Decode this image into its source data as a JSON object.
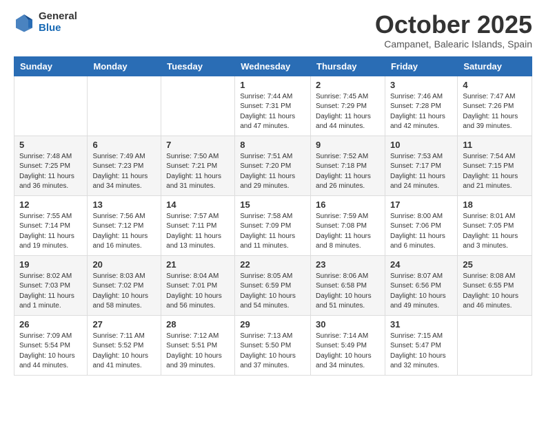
{
  "logo": {
    "general": "General",
    "blue": "Blue"
  },
  "title": "October 2025",
  "location": "Campanet, Balearic Islands, Spain",
  "headers": [
    "Sunday",
    "Monday",
    "Tuesday",
    "Wednesday",
    "Thursday",
    "Friday",
    "Saturday"
  ],
  "weeks": [
    [
      {
        "day": "",
        "info": ""
      },
      {
        "day": "",
        "info": ""
      },
      {
        "day": "",
        "info": ""
      },
      {
        "day": "1",
        "info": "Sunrise: 7:44 AM\nSunset: 7:31 PM\nDaylight: 11 hours and 47 minutes."
      },
      {
        "day": "2",
        "info": "Sunrise: 7:45 AM\nSunset: 7:29 PM\nDaylight: 11 hours and 44 minutes."
      },
      {
        "day": "3",
        "info": "Sunrise: 7:46 AM\nSunset: 7:28 PM\nDaylight: 11 hours and 42 minutes."
      },
      {
        "day": "4",
        "info": "Sunrise: 7:47 AM\nSunset: 7:26 PM\nDaylight: 11 hours and 39 minutes."
      }
    ],
    [
      {
        "day": "5",
        "info": "Sunrise: 7:48 AM\nSunset: 7:25 PM\nDaylight: 11 hours and 36 minutes."
      },
      {
        "day": "6",
        "info": "Sunrise: 7:49 AM\nSunset: 7:23 PM\nDaylight: 11 hours and 34 minutes."
      },
      {
        "day": "7",
        "info": "Sunrise: 7:50 AM\nSunset: 7:21 PM\nDaylight: 11 hours and 31 minutes."
      },
      {
        "day": "8",
        "info": "Sunrise: 7:51 AM\nSunset: 7:20 PM\nDaylight: 11 hours and 29 minutes."
      },
      {
        "day": "9",
        "info": "Sunrise: 7:52 AM\nSunset: 7:18 PM\nDaylight: 11 hours and 26 minutes."
      },
      {
        "day": "10",
        "info": "Sunrise: 7:53 AM\nSunset: 7:17 PM\nDaylight: 11 hours and 24 minutes."
      },
      {
        "day": "11",
        "info": "Sunrise: 7:54 AM\nSunset: 7:15 PM\nDaylight: 11 hours and 21 minutes."
      }
    ],
    [
      {
        "day": "12",
        "info": "Sunrise: 7:55 AM\nSunset: 7:14 PM\nDaylight: 11 hours and 19 minutes."
      },
      {
        "day": "13",
        "info": "Sunrise: 7:56 AM\nSunset: 7:12 PM\nDaylight: 11 hours and 16 minutes."
      },
      {
        "day": "14",
        "info": "Sunrise: 7:57 AM\nSunset: 7:11 PM\nDaylight: 11 hours and 13 minutes."
      },
      {
        "day": "15",
        "info": "Sunrise: 7:58 AM\nSunset: 7:09 PM\nDaylight: 11 hours and 11 minutes."
      },
      {
        "day": "16",
        "info": "Sunrise: 7:59 AM\nSunset: 7:08 PM\nDaylight: 11 hours and 8 minutes."
      },
      {
        "day": "17",
        "info": "Sunrise: 8:00 AM\nSunset: 7:06 PM\nDaylight: 11 hours and 6 minutes."
      },
      {
        "day": "18",
        "info": "Sunrise: 8:01 AM\nSunset: 7:05 PM\nDaylight: 11 hours and 3 minutes."
      }
    ],
    [
      {
        "day": "19",
        "info": "Sunrise: 8:02 AM\nSunset: 7:03 PM\nDaylight: 11 hours and 1 minute."
      },
      {
        "day": "20",
        "info": "Sunrise: 8:03 AM\nSunset: 7:02 PM\nDaylight: 10 hours and 58 minutes."
      },
      {
        "day": "21",
        "info": "Sunrise: 8:04 AM\nSunset: 7:01 PM\nDaylight: 10 hours and 56 minutes."
      },
      {
        "day": "22",
        "info": "Sunrise: 8:05 AM\nSunset: 6:59 PM\nDaylight: 10 hours and 54 minutes."
      },
      {
        "day": "23",
        "info": "Sunrise: 8:06 AM\nSunset: 6:58 PM\nDaylight: 10 hours and 51 minutes."
      },
      {
        "day": "24",
        "info": "Sunrise: 8:07 AM\nSunset: 6:56 PM\nDaylight: 10 hours and 49 minutes."
      },
      {
        "day": "25",
        "info": "Sunrise: 8:08 AM\nSunset: 6:55 PM\nDaylight: 10 hours and 46 minutes."
      }
    ],
    [
      {
        "day": "26",
        "info": "Sunrise: 7:09 AM\nSunset: 5:54 PM\nDaylight: 10 hours and 44 minutes."
      },
      {
        "day": "27",
        "info": "Sunrise: 7:11 AM\nSunset: 5:52 PM\nDaylight: 10 hours and 41 minutes."
      },
      {
        "day": "28",
        "info": "Sunrise: 7:12 AM\nSunset: 5:51 PM\nDaylight: 10 hours and 39 minutes."
      },
      {
        "day": "29",
        "info": "Sunrise: 7:13 AM\nSunset: 5:50 PM\nDaylight: 10 hours and 37 minutes."
      },
      {
        "day": "30",
        "info": "Sunrise: 7:14 AM\nSunset: 5:49 PM\nDaylight: 10 hours and 34 minutes."
      },
      {
        "day": "31",
        "info": "Sunrise: 7:15 AM\nSunset: 5:47 PM\nDaylight: 10 hours and 32 minutes."
      },
      {
        "day": "",
        "info": ""
      }
    ]
  ]
}
